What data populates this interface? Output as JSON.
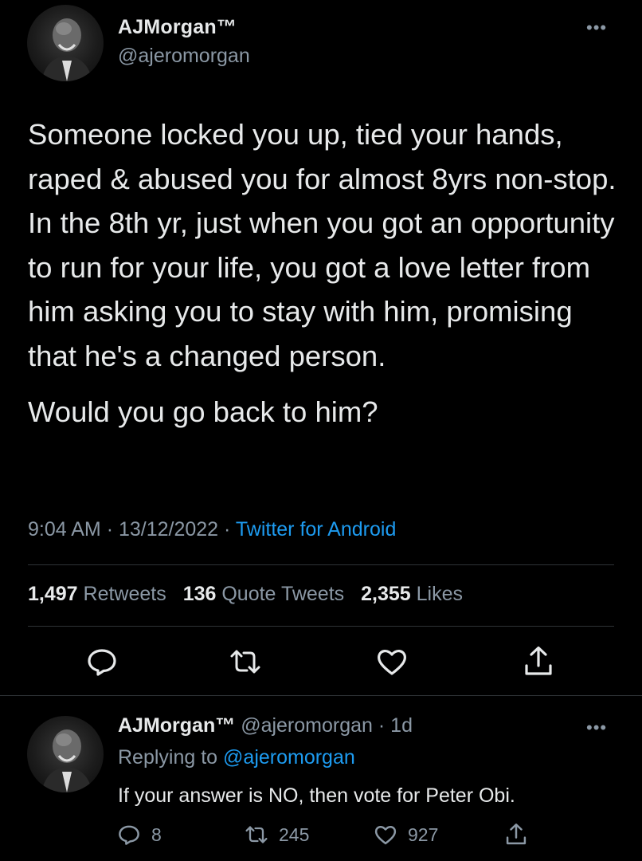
{
  "main_tweet": {
    "author_name": "AJMorgan™",
    "author_handle": "@ajeromorgan",
    "more_icon": "•••",
    "body_paragraphs": [
      "Someone locked you up, tied your hands, raped & abused you for almost 8yrs non-stop. In the 8th yr, just when you got an opportunity to run for your life, you got a love letter from him asking you to stay with him, promising that he's a changed person.",
      "Would you go back to him?"
    ],
    "time": "9:04 AM",
    "date": "13/12/2022",
    "source": "Twitter for Android",
    "stats": {
      "retweets_count": "1,497",
      "retweets_label": "Retweets",
      "quotes_count": "136",
      "quotes_label": "Quote Tweets",
      "likes_count": "2,355",
      "likes_label": "Likes"
    },
    "actions": [
      "reply-icon",
      "retweet-icon",
      "like-icon",
      "share-icon"
    ]
  },
  "reply_tweet": {
    "author_name": "AJMorgan™",
    "author_handle": "@ajeromorgan",
    "age": "1d",
    "replying_prefix": "Replying to",
    "replying_to": "@ajeromorgan",
    "text": "If your answer is NO, then vote for Peter Obi.",
    "reply_count": "8",
    "retweet_count": "245",
    "like_count": "927"
  },
  "colors": {
    "background": "#000000",
    "text": "#e7e9ea",
    "secondary": "#8b98a5",
    "link": "#1d9bf0",
    "divider": "#2f3336"
  }
}
